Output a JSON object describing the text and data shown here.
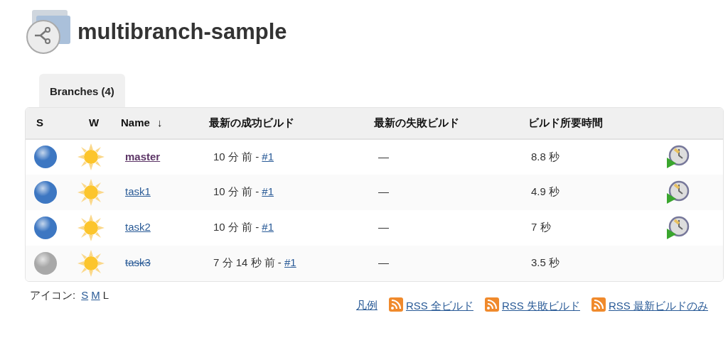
{
  "title": "multibranch-sample",
  "tabs": [
    {
      "label": "Branches (4)",
      "selected": true
    }
  ],
  "table": {
    "columns": [
      "S",
      "W",
      "Name",
      "↓",
      "最新の成功ビルド",
      "最新の失敗ビルド",
      "ビルド所要時間"
    ],
    "rows": [
      {
        "color": "#3d77c2",
        "name": "master",
        "visited": true,
        "disabled": false,
        "last_success": "10 分 前 - ",
        "success_link": "#1",
        "last_failure": "—",
        "duration": "8.8 秒",
        "can_build": true
      },
      {
        "color": "#3d77c2",
        "name": "task1",
        "visited": false,
        "disabled": false,
        "last_success": "10 分 前 - ",
        "success_link": "#1",
        "last_failure": "—",
        "duration": "4.9 秒",
        "can_build": true
      },
      {
        "color": "#3d77c2",
        "name": "task2",
        "visited": false,
        "disabled": false,
        "last_success": "10 分 前 - ",
        "success_link": "#1",
        "last_failure": "—",
        "duration": "7 秒",
        "can_build": true
      },
      {
        "color": "#a8a8a8",
        "name": "task3",
        "visited": false,
        "disabled": true,
        "last_success": "7 分 14 秒 前 - ",
        "success_link": "#1",
        "last_failure": "—",
        "duration": "3.5 秒",
        "can_build": false
      }
    ]
  },
  "icon_size": {
    "label": "アイコン:",
    "options": [
      {
        "label": "S",
        "selected": false
      },
      {
        "label": "M",
        "selected": false
      },
      {
        "label": "L",
        "selected": true
      }
    ]
  },
  "footer_links": [
    {
      "kind": "legend",
      "label": "凡例"
    },
    {
      "kind": "rss",
      "label": "RSS 全ビルド"
    },
    {
      "kind": "rss",
      "label": "RSS 失敗ビルド"
    },
    {
      "kind": "rss",
      "label": "RSS 最新ビルドのみ"
    }
  ]
}
